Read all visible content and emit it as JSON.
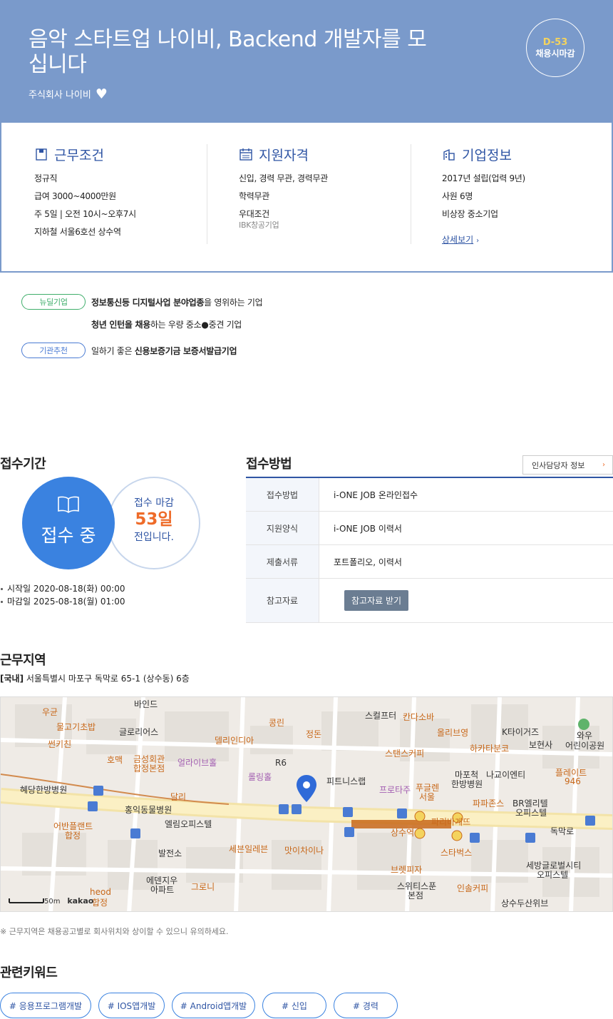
{
  "header": {
    "title": "음악 스타트업 나이비, Backend 개발자를 모십니다",
    "company": "주식회사 나이비",
    "dday": "D-53",
    "dday_label": "채용시마감"
  },
  "conditions": {
    "work": {
      "title": "근무조건",
      "items": [
        "정규직",
        "급여 3000~4000만원",
        "주 5일 | 오전 10시~오후7시",
        "지하철 서울6호선 상수역"
      ]
    },
    "qual": {
      "title": "지원자격",
      "items": [
        "신입, 경력 무관, 경력무관",
        "학력무관",
        "우대조건"
      ],
      "sub": "IBK창공기업"
    },
    "company": {
      "title": "기업정보",
      "items": [
        "2017년 설립(업력 9년)",
        "사원 6명",
        "비상장 중소기업"
      ],
      "more": "상세보기"
    }
  },
  "badges": {
    "newdeal_label": "뉴딜기업",
    "newdeal_line1_bold": "정보통신등 디지털사업 분야업종",
    "newdeal_line1_rest": "을 영위하는 기업",
    "newdeal_line2_bold": "청년 인턴을 채용",
    "newdeal_line2_rest": "하는 우량 중소●중견 기업",
    "agency_label": "기관추천",
    "agency_pre": "일하기 좋은 ",
    "agency_bold": "신용보증기금 보증서발급기업"
  },
  "period": {
    "title": "접수기간",
    "status": "접수 중",
    "deadline_top": "접수 마감",
    "deadline_days": "53일",
    "deadline_bottom": "전입니다.",
    "start": "시작일 2020-08-18(화) 00:00",
    "end": "마감일 2025-08-18(월) 01:00"
  },
  "method": {
    "title": "접수방법",
    "hr_button": "인사담당자 정보",
    "rows": [
      {
        "k": "접수방법",
        "v": "i-ONE JOB 온라인접수"
      },
      {
        "k": "지원양식",
        "v": "i-ONE JOB 이력서"
      },
      {
        "k": "제출서류",
        "v": "포트폴리오, 이력서"
      },
      {
        "k": "참고자료",
        "v": "참고자료 받기"
      }
    ]
  },
  "location": {
    "title": "근무지역",
    "region": "[국내]",
    "address": "서울특별시 마포구 독막로 65-1 (상수동) 6층",
    "note": "※ 근무지역은 채용공고별로 회사위치와 상이할 수 있으니 유의하세요.",
    "map_scale": "50m",
    "map_brand": "kakao"
  },
  "map_labels": [
    "우균",
    "바인드",
    "물고기초밥",
    "글로리어스",
    "콩린",
    "정돈",
    "스컬프터",
    "칸다소바",
    "올리브영",
    "K타이거즈",
    "보현사",
    "와우",
    "어린이공원",
    "썬키친",
    "호맥",
    "금성회관",
    "합정본점",
    "얼라이브홀",
    "델리인디아",
    "롤링홀",
    "R6",
    "스탠스커피",
    "하카타분코",
    "마포척",
    "한방병원",
    "나교이엔티",
    "플레이트",
    "946",
    "혜당한방병원",
    "피트니스랩",
    "프로타주",
    "푸글렌",
    "서울",
    "파파존스",
    "BR엘리텔",
    "오피스텔",
    "홍익동물병원",
    "달리",
    "엘림오피스텔",
    "어반플랜트",
    "합정",
    "파리바게뜨",
    "독막로",
    "상수역",
    "스타벅스",
    "세븐일레븐",
    "맛이차이나",
    "발전소",
    "브렛피자",
    "에덴지우",
    "아파트",
    "그로니",
    "스위티스푼",
    "본점",
    "인솔커피",
    "세방글로벌시티",
    "오피스텔",
    "상수두산위브",
    "heod",
    "합정"
  ],
  "keywords": {
    "title": "관련키워드",
    "items": [
      "# 응용프로그램개발",
      "# IOS앱개발",
      "# Android앱개발",
      "# 신입",
      "# 경력"
    ]
  },
  "colors": {
    "header": "#7a9acb",
    "accent": "#2f55a4",
    "status": "#3a82e0",
    "deadline": "#ee6b29"
  }
}
